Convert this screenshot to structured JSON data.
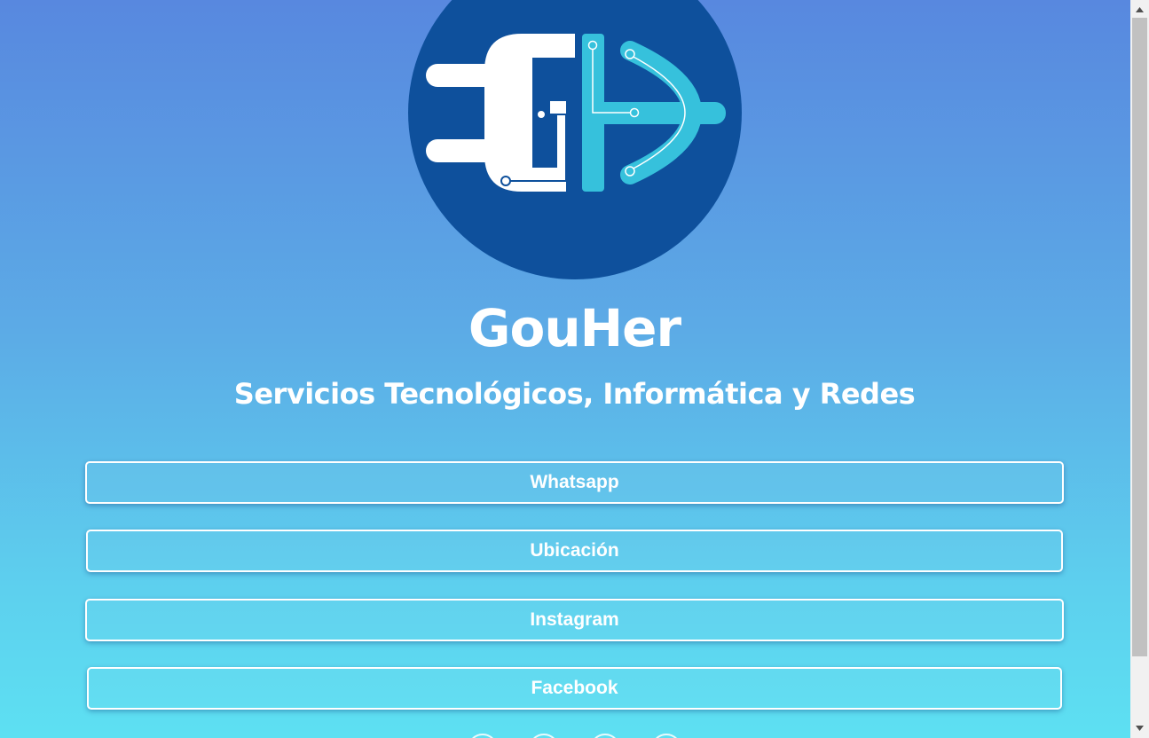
{
  "brand": {
    "name": "GouHer",
    "tagline": "Servicios Tecnológicos, Informática y Redes",
    "logo_icon": "gh-plug-circuit-logo"
  },
  "links": [
    {
      "label": "Whatsapp"
    },
    {
      "label": "Ubicación"
    },
    {
      "label": "Instagram"
    },
    {
      "label": "Facebook"
    }
  ],
  "social_icons": [
    "social-icon-1",
    "social-icon-2",
    "social-icon-3",
    "social-icon-4"
  ],
  "colors": {
    "background_top": "#5888df",
    "background_bottom": "#5de0f2",
    "logo_circle": "#0e509c",
    "logo_accent": "#36c1dc",
    "text": "#ffffff"
  }
}
